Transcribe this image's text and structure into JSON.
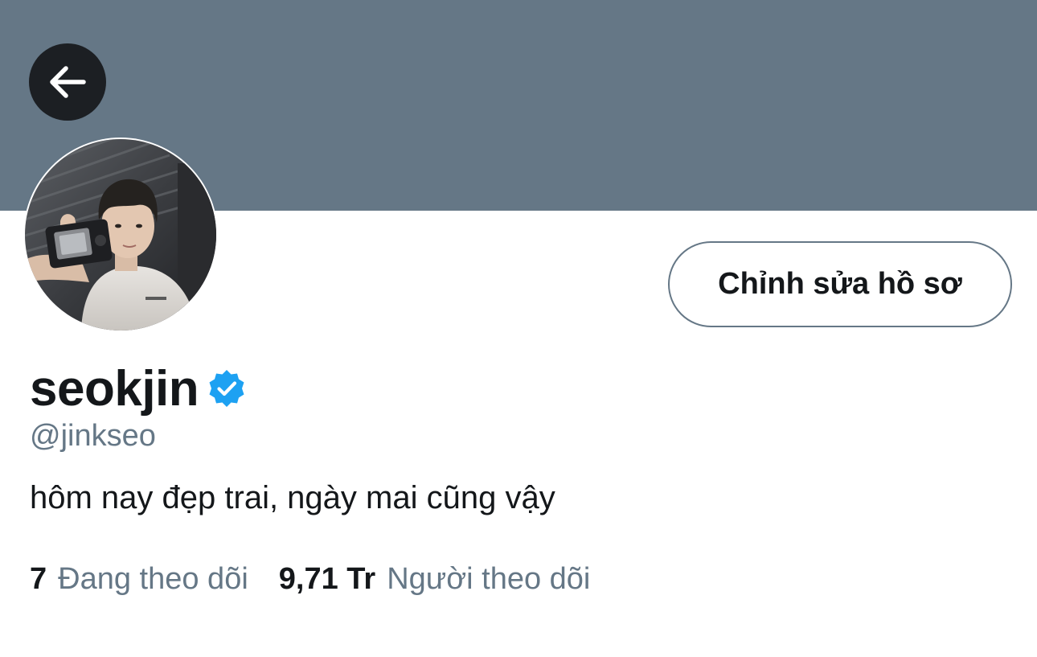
{
  "profile": {
    "back_icon": "arrow-left-icon",
    "avatar_alt": "profile photo",
    "edit_button_label": "Chỉnh sửa hồ sơ",
    "display_name": "seokjin",
    "verified_icon": "verified-badge-icon",
    "handle": "@jinkseo",
    "bio": "hôm nay đẹp trai, ngày mai cũng vậy",
    "following_count": "7",
    "following_label": "Đang theo dõi",
    "followers_count": "9,71 Tr",
    "followers_label": "Người theo dõi"
  },
  "colors": {
    "banner": "#657786",
    "back_button": "#1c1f23",
    "verified": "#1da1f2",
    "secondary_text": "#657786",
    "primary_text": "#14171a"
  }
}
